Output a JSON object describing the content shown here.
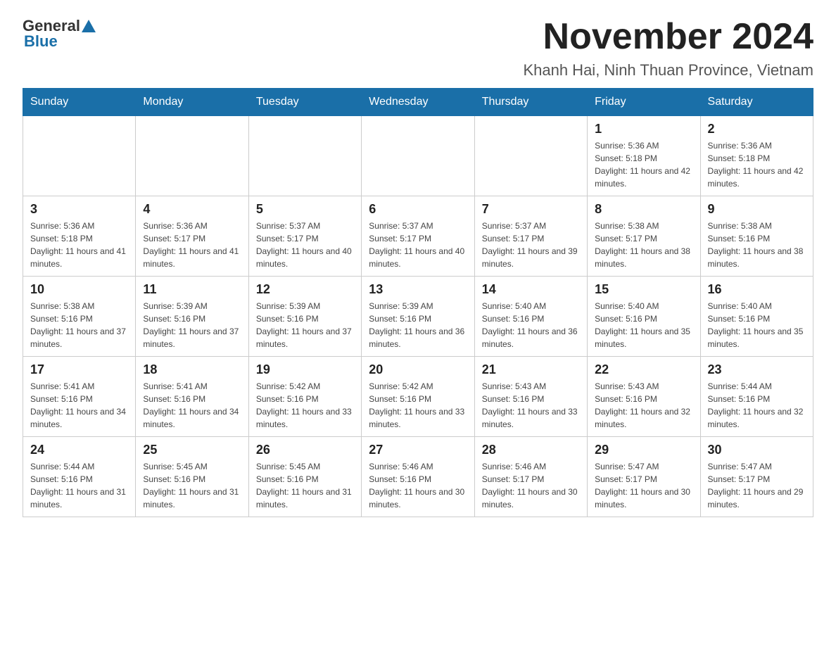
{
  "header": {
    "logo": {
      "general": "General",
      "blue": "Blue"
    },
    "title": "November 2024",
    "subtitle": "Khanh Hai, Ninh Thuan Province, Vietnam"
  },
  "days_of_week": [
    "Sunday",
    "Monday",
    "Tuesday",
    "Wednesday",
    "Thursday",
    "Friday",
    "Saturday"
  ],
  "weeks": [
    [
      {
        "day": "",
        "sunrise": "",
        "sunset": "",
        "daylight": ""
      },
      {
        "day": "",
        "sunrise": "",
        "sunset": "",
        "daylight": ""
      },
      {
        "day": "",
        "sunrise": "",
        "sunset": "",
        "daylight": ""
      },
      {
        "day": "",
        "sunrise": "",
        "sunset": "",
        "daylight": ""
      },
      {
        "day": "",
        "sunrise": "",
        "sunset": "",
        "daylight": ""
      },
      {
        "day": "1",
        "sunrise": "Sunrise: 5:36 AM",
        "sunset": "Sunset: 5:18 PM",
        "daylight": "Daylight: 11 hours and 42 minutes."
      },
      {
        "day": "2",
        "sunrise": "Sunrise: 5:36 AM",
        "sunset": "Sunset: 5:18 PM",
        "daylight": "Daylight: 11 hours and 42 minutes."
      }
    ],
    [
      {
        "day": "3",
        "sunrise": "Sunrise: 5:36 AM",
        "sunset": "Sunset: 5:18 PM",
        "daylight": "Daylight: 11 hours and 41 minutes."
      },
      {
        "day": "4",
        "sunrise": "Sunrise: 5:36 AM",
        "sunset": "Sunset: 5:17 PM",
        "daylight": "Daylight: 11 hours and 41 minutes."
      },
      {
        "day": "5",
        "sunrise": "Sunrise: 5:37 AM",
        "sunset": "Sunset: 5:17 PM",
        "daylight": "Daylight: 11 hours and 40 minutes."
      },
      {
        "day": "6",
        "sunrise": "Sunrise: 5:37 AM",
        "sunset": "Sunset: 5:17 PM",
        "daylight": "Daylight: 11 hours and 40 minutes."
      },
      {
        "day": "7",
        "sunrise": "Sunrise: 5:37 AM",
        "sunset": "Sunset: 5:17 PM",
        "daylight": "Daylight: 11 hours and 39 minutes."
      },
      {
        "day": "8",
        "sunrise": "Sunrise: 5:38 AM",
        "sunset": "Sunset: 5:17 PM",
        "daylight": "Daylight: 11 hours and 38 minutes."
      },
      {
        "day": "9",
        "sunrise": "Sunrise: 5:38 AM",
        "sunset": "Sunset: 5:16 PM",
        "daylight": "Daylight: 11 hours and 38 minutes."
      }
    ],
    [
      {
        "day": "10",
        "sunrise": "Sunrise: 5:38 AM",
        "sunset": "Sunset: 5:16 PM",
        "daylight": "Daylight: 11 hours and 37 minutes."
      },
      {
        "day": "11",
        "sunrise": "Sunrise: 5:39 AM",
        "sunset": "Sunset: 5:16 PM",
        "daylight": "Daylight: 11 hours and 37 minutes."
      },
      {
        "day": "12",
        "sunrise": "Sunrise: 5:39 AM",
        "sunset": "Sunset: 5:16 PM",
        "daylight": "Daylight: 11 hours and 37 minutes."
      },
      {
        "day": "13",
        "sunrise": "Sunrise: 5:39 AM",
        "sunset": "Sunset: 5:16 PM",
        "daylight": "Daylight: 11 hours and 36 minutes."
      },
      {
        "day": "14",
        "sunrise": "Sunrise: 5:40 AM",
        "sunset": "Sunset: 5:16 PM",
        "daylight": "Daylight: 11 hours and 36 minutes."
      },
      {
        "day": "15",
        "sunrise": "Sunrise: 5:40 AM",
        "sunset": "Sunset: 5:16 PM",
        "daylight": "Daylight: 11 hours and 35 minutes."
      },
      {
        "day": "16",
        "sunrise": "Sunrise: 5:40 AM",
        "sunset": "Sunset: 5:16 PM",
        "daylight": "Daylight: 11 hours and 35 minutes."
      }
    ],
    [
      {
        "day": "17",
        "sunrise": "Sunrise: 5:41 AM",
        "sunset": "Sunset: 5:16 PM",
        "daylight": "Daylight: 11 hours and 34 minutes."
      },
      {
        "day": "18",
        "sunrise": "Sunrise: 5:41 AM",
        "sunset": "Sunset: 5:16 PM",
        "daylight": "Daylight: 11 hours and 34 minutes."
      },
      {
        "day": "19",
        "sunrise": "Sunrise: 5:42 AM",
        "sunset": "Sunset: 5:16 PM",
        "daylight": "Daylight: 11 hours and 33 minutes."
      },
      {
        "day": "20",
        "sunrise": "Sunrise: 5:42 AM",
        "sunset": "Sunset: 5:16 PM",
        "daylight": "Daylight: 11 hours and 33 minutes."
      },
      {
        "day": "21",
        "sunrise": "Sunrise: 5:43 AM",
        "sunset": "Sunset: 5:16 PM",
        "daylight": "Daylight: 11 hours and 33 minutes."
      },
      {
        "day": "22",
        "sunrise": "Sunrise: 5:43 AM",
        "sunset": "Sunset: 5:16 PM",
        "daylight": "Daylight: 11 hours and 32 minutes."
      },
      {
        "day": "23",
        "sunrise": "Sunrise: 5:44 AM",
        "sunset": "Sunset: 5:16 PM",
        "daylight": "Daylight: 11 hours and 32 minutes."
      }
    ],
    [
      {
        "day": "24",
        "sunrise": "Sunrise: 5:44 AM",
        "sunset": "Sunset: 5:16 PM",
        "daylight": "Daylight: 11 hours and 31 minutes."
      },
      {
        "day": "25",
        "sunrise": "Sunrise: 5:45 AM",
        "sunset": "Sunset: 5:16 PM",
        "daylight": "Daylight: 11 hours and 31 minutes."
      },
      {
        "day": "26",
        "sunrise": "Sunrise: 5:45 AM",
        "sunset": "Sunset: 5:16 PM",
        "daylight": "Daylight: 11 hours and 31 minutes."
      },
      {
        "day": "27",
        "sunrise": "Sunrise: 5:46 AM",
        "sunset": "Sunset: 5:16 PM",
        "daylight": "Daylight: 11 hours and 30 minutes."
      },
      {
        "day": "28",
        "sunrise": "Sunrise: 5:46 AM",
        "sunset": "Sunset: 5:17 PM",
        "daylight": "Daylight: 11 hours and 30 minutes."
      },
      {
        "day": "29",
        "sunrise": "Sunrise: 5:47 AM",
        "sunset": "Sunset: 5:17 PM",
        "daylight": "Daylight: 11 hours and 30 minutes."
      },
      {
        "day": "30",
        "sunrise": "Sunrise: 5:47 AM",
        "sunset": "Sunset: 5:17 PM",
        "daylight": "Daylight: 11 hours and 29 minutes."
      }
    ]
  ]
}
